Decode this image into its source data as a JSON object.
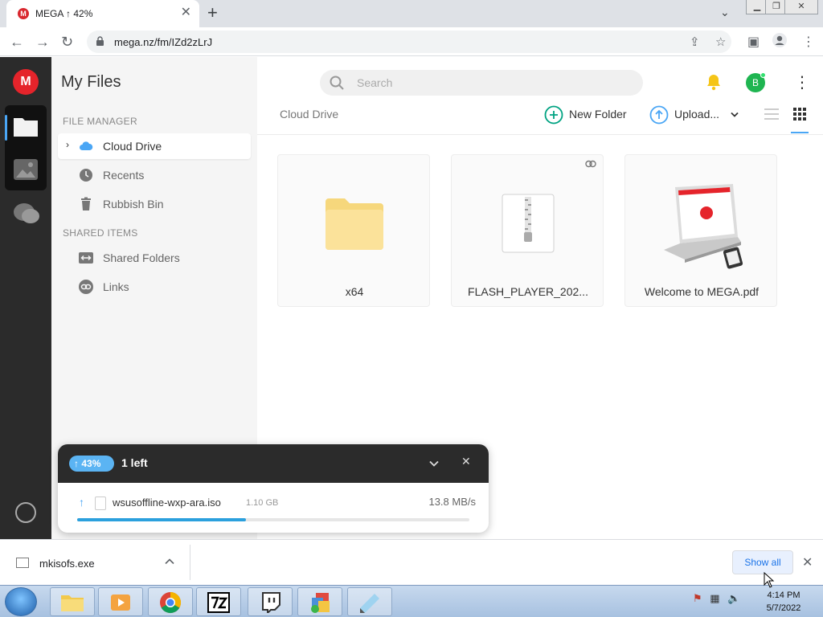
{
  "browser": {
    "tab_title": "MEGA ↑ 42%",
    "url": "mega.nz/fm/IZd2zLrJ"
  },
  "sidebar": {
    "title": "My Files",
    "section_file_manager": "FILE MANAGER",
    "section_shared": "SHARED ITEMS",
    "items": [
      {
        "label": "Cloud Drive",
        "icon": "cloud-icon"
      },
      {
        "label": "Recents",
        "icon": "clock-icon"
      },
      {
        "label": "Rubbish Bin",
        "icon": "trash-icon"
      },
      {
        "label": "Shared Folders",
        "icon": "shared-folder-icon"
      },
      {
        "label": "Links",
        "icon": "link-icon"
      }
    ]
  },
  "main": {
    "search_placeholder": "Search",
    "avatar_initial": "B",
    "breadcrumb": "Cloud Drive",
    "new_folder_label": "New Folder",
    "upload_label": "Upload...",
    "files": [
      {
        "name": "x64",
        "type": "folder"
      },
      {
        "name": "FLASH_PLAYER_202...",
        "type": "zip"
      },
      {
        "name": "Welcome to MEGA.pdf",
        "type": "pdf"
      }
    ]
  },
  "transfer": {
    "percent": "43%",
    "percent_value": 43,
    "remaining": "1 left",
    "file_name": "wsusoffline-wxp-ara.iso",
    "file_size": "1.10 GB",
    "speed": "13.8 MB/s"
  },
  "download_shelf": {
    "file_name": "mkisofs.exe",
    "show_all_label": "Show all"
  },
  "taskbar": {
    "time": "4:14 PM",
    "date": "5/7/2022"
  },
  "colors": {
    "mega_red": "#e5242b",
    "accent_blue": "#4aa6f5",
    "action_green": "#00a382",
    "folder_yellow": "#fbe29a"
  }
}
